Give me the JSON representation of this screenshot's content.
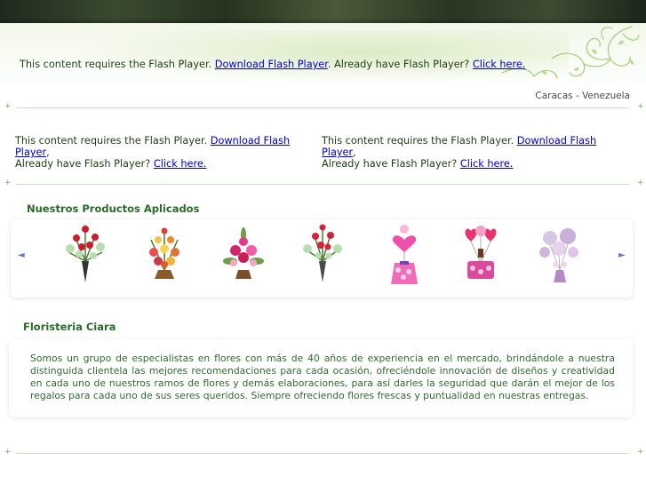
{
  "header": {
    "flash": {
      "prefix": "This content requires the Flash Player. ",
      "download_link": "Download Flash Player",
      "middle": ". Already have Flash Player? ",
      "click_link": "Click here."
    },
    "location": "Caracas  -  Venezuela"
  },
  "banners": [
    {
      "prefix": "This content requires the Flash Player. ",
      "download_link": "Download Flash Player",
      "middle": ",",
      "line2": "Already have Flash Player? ",
      "click_link": "Click here."
    },
    {
      "prefix": "This content requires the Flash Player. ",
      "download_link": "Download Flash Player",
      "middle": ",",
      "line2": "Already have Flash Player? ",
      "click_link": "Click here."
    }
  ],
  "products": {
    "title": "Nuestros Productos Aplicados",
    "items": [
      {
        "icon": "red-roses-vase-icon"
      },
      {
        "icon": "mixed-flower-arrangement-icon"
      },
      {
        "icon": "pink-flower-arrangement-icon"
      },
      {
        "icon": "roses-vase-icon"
      },
      {
        "icon": "heart-balloon-gift-icon"
      },
      {
        "icon": "balloon-bouquet-gift-icon"
      },
      {
        "icon": "balloon-arrangement-icon"
      }
    ],
    "prev_icon": "◄",
    "next_icon": "►"
  },
  "about": {
    "title": "Floristeria Ciara",
    "text": "Somos un grupo de especialistas en flores con más de 40 años de experiencia en el mercado, brindándole a nuestra distinguida clientela las mejores recomendaciones para cada ocasión, ofreciéndole innovación de diseños y creatividad en cada uno de nuestros ramos de flores y demás elaboraciones, para así darles la seguridad que darán el mejor de los regalos para cada uno de sus seres queridos. Siempre ofreciendo flores frescas y puntualidad en nuestras entregas."
  },
  "colors": {
    "accent_green": "#2a6a2a",
    "link_blue": "#0000cc",
    "divider": "#cfd8c6"
  }
}
